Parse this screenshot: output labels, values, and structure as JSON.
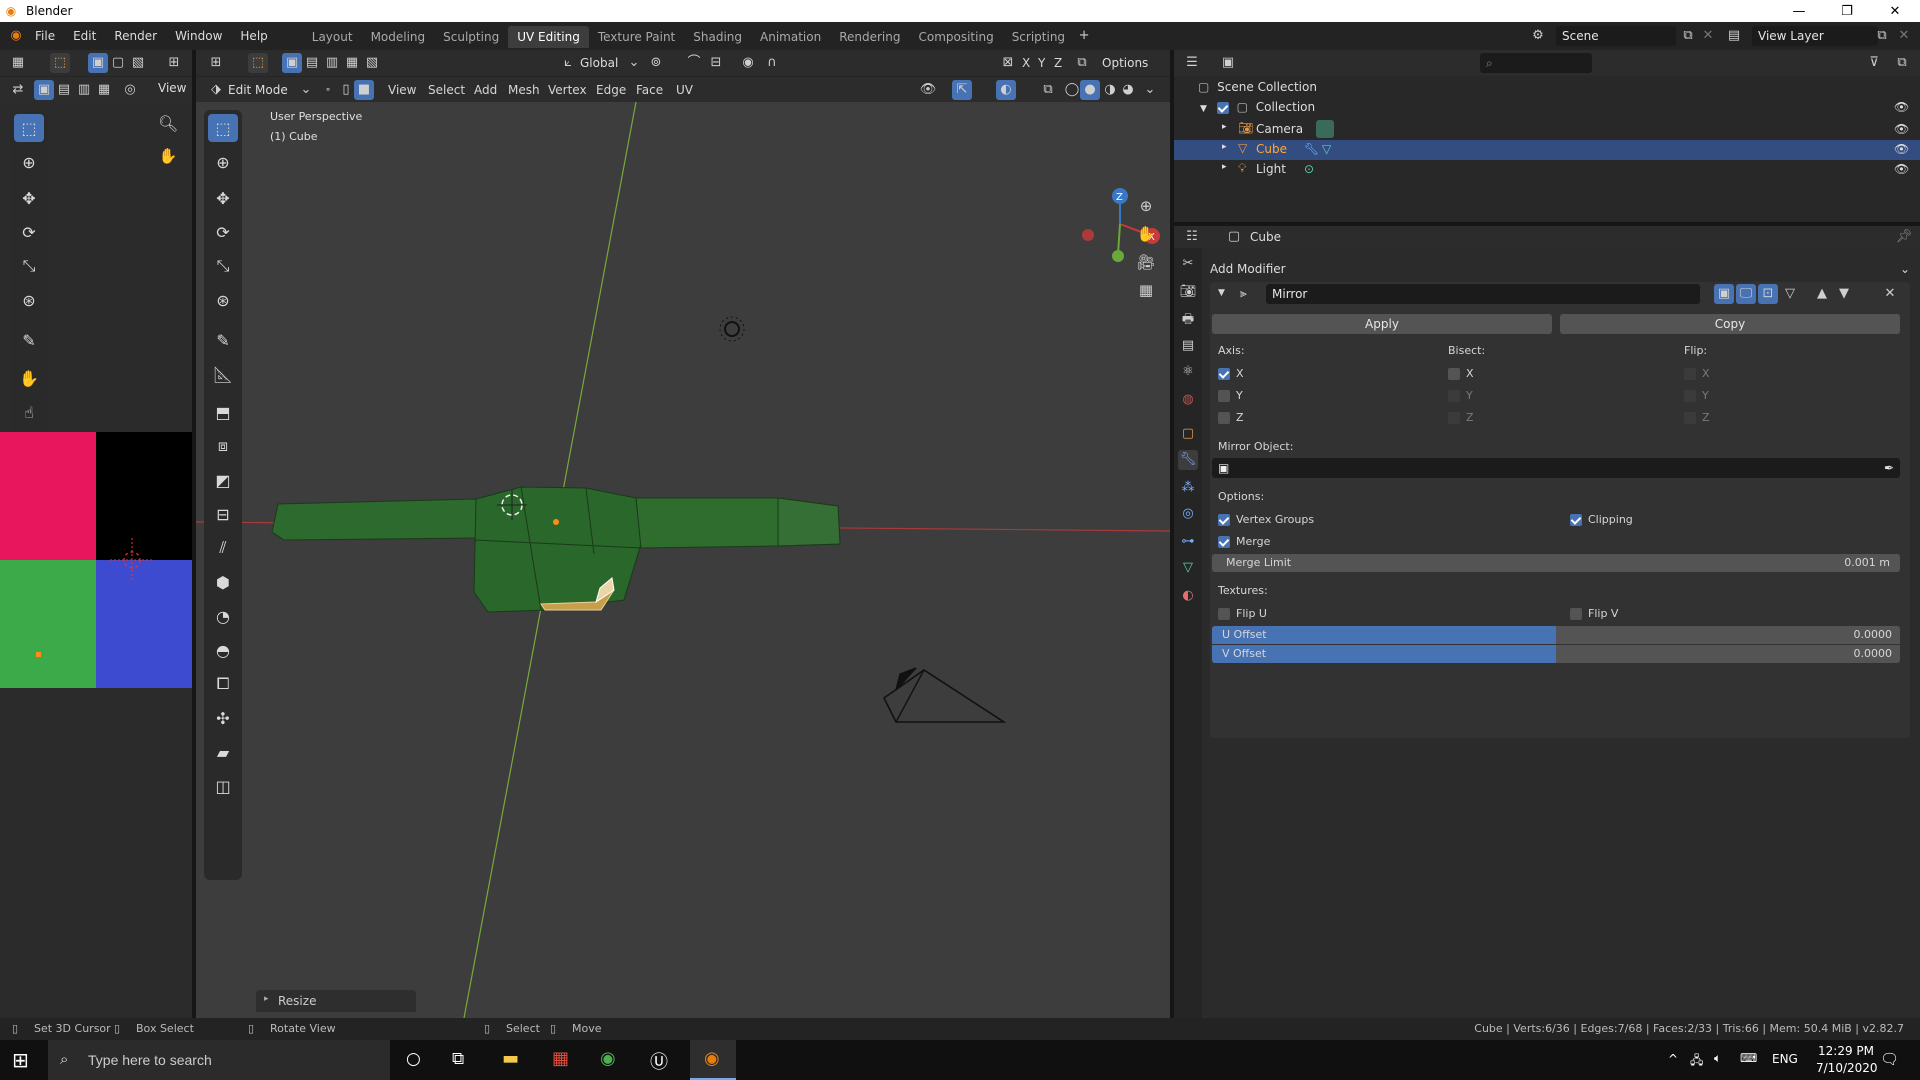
{
  "window": {
    "title": "Blender",
    "minimize": "—",
    "maximize": "❐",
    "close": "✕"
  },
  "menubar": {
    "items": [
      "File",
      "Edit",
      "Render",
      "Window",
      "Help"
    ]
  },
  "workspaces": [
    "Layout",
    "Modeling",
    "Sculpting",
    "UV Editing",
    "Texture Paint",
    "Shading",
    "Animation",
    "Rendering",
    "Compositing",
    "Scripting"
  ],
  "active_workspace": "UV Editing",
  "scene": {
    "name": "Scene",
    "view_layer": "View Layer"
  },
  "uv_editor": {
    "view_label": "View"
  },
  "viewport": {
    "transform_orientation": "Global",
    "options_label": "Options",
    "mode": "Edit Mode",
    "menus": [
      "View",
      "Select",
      "Add",
      "Mesh",
      "Vertex",
      "Edge",
      "Face",
      "UV"
    ],
    "perspective": "User Perspective",
    "object": "(1) Cube",
    "last_op": "Resize",
    "axes": {
      "x": "X",
      "y": "Y",
      "z": "Z"
    }
  },
  "outliner": {
    "root": "Scene Collection",
    "collection": "Collection",
    "items": [
      {
        "label": "Camera",
        "selected": false
      },
      {
        "label": "Cube",
        "selected": true
      },
      {
        "label": "Light",
        "selected": false
      }
    ]
  },
  "properties": {
    "object_name": "Cube",
    "add_modifier": "Add Modifier",
    "modifier_name": "Mirror",
    "apply": "Apply",
    "copy": "Copy",
    "axis_label": "Axis:",
    "bisect_label": "Bisect:",
    "flip_label": "Flip:",
    "axes": [
      "X",
      "Y",
      "Z"
    ],
    "axis_checked": [
      true,
      false,
      false
    ],
    "mirror_object_label": "Mirror Object:",
    "options_label": "Options:",
    "vertex_groups": "Vertex Groups",
    "clipping": "Clipping",
    "merge": "Merge",
    "merge_limit_label": "Merge Limit",
    "merge_limit_value": "0.001 m",
    "textures_label": "Textures:",
    "flip_u": "Flip U",
    "flip_v": "Flip V",
    "u_offset_label": "U Offset",
    "u_offset_value": "0.0000",
    "v_offset_label": "V Offset",
    "v_offset_value": "0.0000"
  },
  "statusbar": {
    "hint1": "Set 3D Cursor",
    "hint2": "Box Select",
    "hint3": "Rotate View",
    "hint4": "Select",
    "hint5": "Move",
    "stats": "Cube | Verts:6/36 | Edges:7/68 | Faces:2/33 | Tris:66 | Mem: 50.4 MiB | v2.82.7"
  },
  "taskbar": {
    "search_placeholder": "Type here to search",
    "lang": "ENG",
    "time": "12:29 PM",
    "date": "7/10/2020"
  },
  "colors": {
    "accent": "#4772b3",
    "selected_row": "#334d80",
    "viewport_bg": "#3d3d3d"
  }
}
